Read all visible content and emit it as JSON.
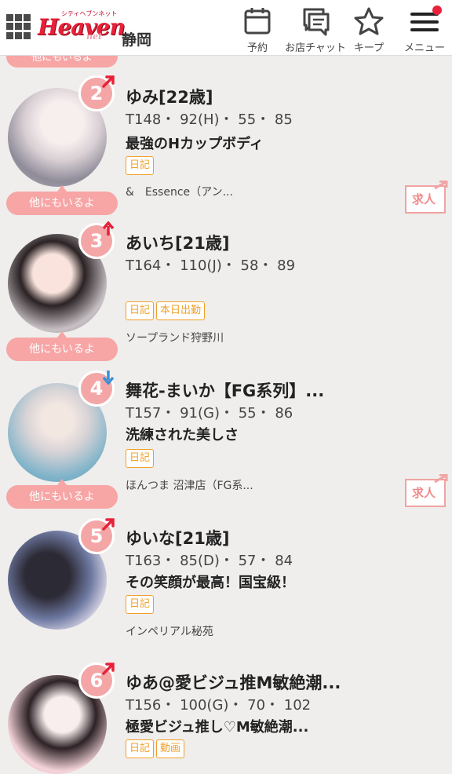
{
  "header": {
    "area": "静岡",
    "logo_small": "シティヘブンネット",
    "logo_main": "Heaven",
    "logo_sub": "net",
    "buttons": [
      {
        "label": "予約"
      },
      {
        "label": "お店チャット"
      },
      {
        "label": "キープ"
      },
      {
        "label": "メニュー"
      }
    ]
  },
  "peek_badge": "他にもいるよ",
  "items": [
    {
      "rank": "2",
      "trend": "up",
      "name": "ゆみ[22歳]",
      "specs": "T148・ 92(H)・ 55・ 85",
      "catch": "最強のHカップボディ",
      "tags": [
        "日記"
      ],
      "shop": "&　Essence（アン...",
      "other": "他にもいるよ",
      "recruit": "求人"
    },
    {
      "rank": "3",
      "trend": "rise",
      "name": "あいち[21歳]",
      "specs": "T164・ 110(J)・ 58・ 89",
      "catch": "",
      "tags": [
        "日記",
        "本日出勤"
      ],
      "shop": "ソープランド狩野川",
      "other": "他にもいるよ",
      "recruit": ""
    },
    {
      "rank": "4",
      "trend": "down",
      "name": "舞花-まいか【FG系列】...",
      "specs": "T157・ 91(G)・ 55・ 86",
      "catch": "洗練された美しさ",
      "tags": [
        "日記"
      ],
      "shop": "ほんつま 沼津店（FG系...",
      "other": "他にもいるよ",
      "recruit": "求人"
    },
    {
      "rank": "5",
      "trend": "up",
      "name": "ゆいな[21歳]",
      "specs": "T163・ 85(D)・ 57・ 84",
      "catch": "その笑顔が最高！国宝級！",
      "tags": [
        "日記"
      ],
      "shop": "インペリアル秘苑",
      "other": "",
      "recruit": ""
    },
    {
      "rank": "6",
      "trend": "up",
      "name": "ゆあ@愛ビジュ推M敏絶潮...",
      "specs": "T156・ 100(G)・ 70・ 102",
      "catch": "極愛ビジュ推し♡M敏絶潮...",
      "tags": [
        "日記",
        "動画"
      ],
      "shop": "",
      "other": "",
      "recruit": ""
    }
  ],
  "colors": {
    "accent": "#e8213a",
    "badge": "#f7a5a5",
    "tag": "#f1a028",
    "up": "#e8213a",
    "down": "#3a8fd8"
  }
}
